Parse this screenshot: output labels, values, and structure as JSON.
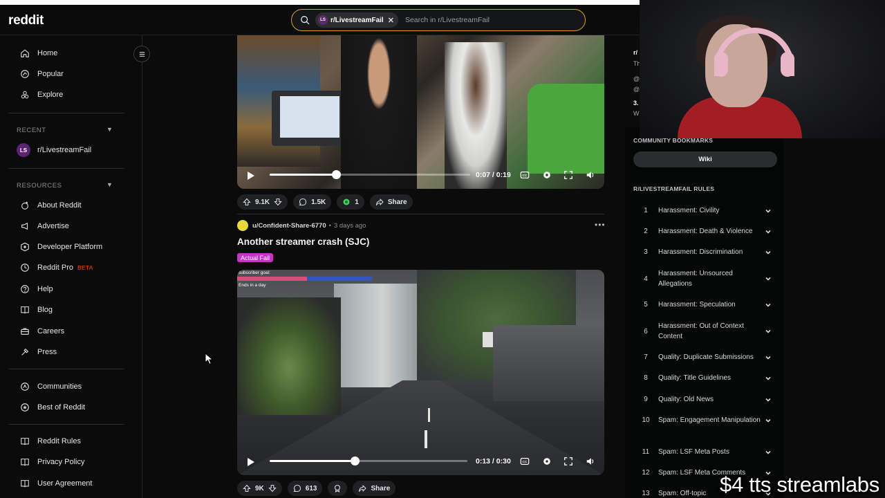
{
  "header": {
    "logo": "reddit",
    "search_chip": "r/LivestreamFail",
    "chip_avatar": "LS",
    "search_placeholder": "Search in r/LivestreamFail"
  },
  "sidebar": {
    "main": [
      {
        "label": "Home",
        "icon": "home-icon"
      },
      {
        "label": "Popular",
        "icon": "popular-icon"
      },
      {
        "label": "Explore",
        "icon": "explore-icon"
      }
    ],
    "recent_label": "RECENT",
    "recent_items": [
      {
        "label": "r/LivestreamFail",
        "avatar": "LS"
      }
    ],
    "resources_label": "RESOURCES",
    "resources": [
      {
        "label": "About Reddit",
        "icon": "about-icon"
      },
      {
        "label": "Advertise",
        "icon": "megaphone-icon"
      },
      {
        "label": "Developer Platform",
        "icon": "developer-icon"
      },
      {
        "label": "Reddit Pro",
        "icon": "pro-icon",
        "badge": "BETA"
      },
      {
        "label": "Help",
        "icon": "help-icon"
      },
      {
        "label": "Blog",
        "icon": "blog-icon"
      },
      {
        "label": "Careers",
        "icon": "careers-icon"
      },
      {
        "label": "Press",
        "icon": "press-icon"
      }
    ],
    "communities": [
      {
        "label": "Communities",
        "icon": "communities-icon"
      },
      {
        "label": "Best of Reddit",
        "icon": "best-icon"
      }
    ],
    "legal": [
      {
        "label": "Reddit Rules",
        "icon": "rules-icon"
      },
      {
        "label": "Privacy Policy",
        "icon": "privacy-icon"
      },
      {
        "label": "User Agreement",
        "icon": "agreement-icon"
      }
    ]
  },
  "post1": {
    "time": "0:07 / 0:19",
    "progress": 0.33,
    "upvotes": "9.1K",
    "comments": "1.5K",
    "awards": "1",
    "share": "Share"
  },
  "post2": {
    "username": "u/Confident-Share-6770",
    "age": "3 days ago",
    "title": "Another streamer crash (SJC)",
    "flair": "Actual Fail",
    "overlay_goal": "subscriber goal:",
    "overlay_ends": "Ends in a day",
    "time": "0:13 / 0:30",
    "progress": 0.43,
    "upvotes": "9K",
    "comments": "613",
    "share": "Share"
  },
  "community": {
    "lines": [
      "r/",
      "Th",
      "@",
      "@",
      "3.",
      "W"
    ]
  },
  "right_panel": {
    "bookmarks_heading": "COMMUNITY BOOKMARKS",
    "wiki_label": "Wiki",
    "rules_heading": "R/LIVESTREAMFAIL RULES",
    "rules": [
      {
        "num": "1",
        "text": "Harassment: Civility"
      },
      {
        "num": "2",
        "text": "Harassment: Death & Violence"
      },
      {
        "num": "3",
        "text": "Harassment: Discrimination"
      },
      {
        "num": "4",
        "text": "Harassment: Unsourced Allegations"
      },
      {
        "num": "5",
        "text": "Harassment: Speculation"
      },
      {
        "num": "6",
        "text": "Harassment: Out of Context Content"
      },
      {
        "num": "7",
        "text": "Quality: Duplicate Submissions"
      },
      {
        "num": "8",
        "text": "Quality: Title Guidelines"
      },
      {
        "num": "9",
        "text": "Quality: Old News"
      },
      {
        "num": "10",
        "text": "Spam: Engagement Manipulation"
      },
      {
        "num": "11",
        "text": "Spam: LSF Meta Posts"
      },
      {
        "num": "12",
        "text": "Spam: LSF Meta Comments"
      },
      {
        "num": "13",
        "text": "Spam: Off-topic"
      }
    ]
  },
  "overlay": {
    "tts": "$4 tts streamlabs"
  },
  "colors": {
    "accent_search": "#d6a31c",
    "beta": "#ff4500",
    "flair": "#c534c9"
  }
}
